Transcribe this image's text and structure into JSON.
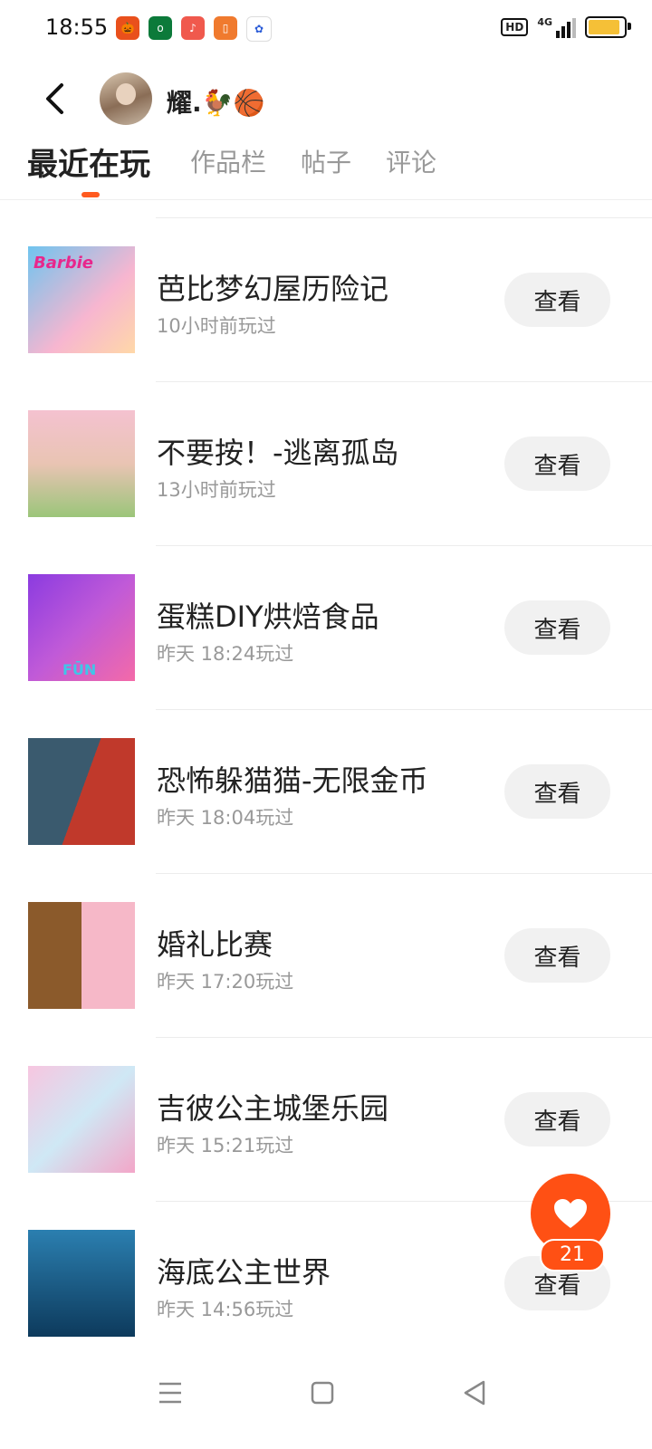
{
  "status_bar": {
    "time": "18:55",
    "network_badge": "HD",
    "network_type": "4G",
    "notification_icons": [
      "pumpkin-app-icon",
      "oppo-app-icon",
      "music-app-icon",
      "book-app-icon",
      "baidu-app-icon"
    ]
  },
  "header": {
    "username": "耀.🐓🏀",
    "back_icon": "chevron-left-icon"
  },
  "tabs": [
    {
      "label": "最近在玩",
      "active": true
    },
    {
      "label": "作品栏",
      "active": false
    },
    {
      "label": "帖子",
      "active": false
    },
    {
      "label": "评论",
      "active": false
    }
  ],
  "games": [
    {
      "name": "芭比梦幻屋历险记",
      "played": "10小时前玩过",
      "button": "查看",
      "thumb_text": "Barbie"
    },
    {
      "name": "不要按！-逃离孤岛",
      "played": "13小时前玩过",
      "button": "查看"
    },
    {
      "name": "蛋糕DIY烘焙食品",
      "played": "昨天 18:24玩过",
      "button": "查看",
      "thumb_text": "FŪN"
    },
    {
      "name": "恐怖躲猫猫-无限金币",
      "played": "昨天 18:04玩过",
      "button": "查看"
    },
    {
      "name": "婚礼比赛",
      "played": "昨天 17:20玩过",
      "button": "查看"
    },
    {
      "name": "吉彼公主城堡乐园",
      "played": "昨天 15:21玩过",
      "button": "查看"
    },
    {
      "name": "海底公主世界",
      "played": "昨天 14:56玩过",
      "button": "查看"
    }
  ],
  "like_fab": {
    "count": "21",
    "icon": "heart-icon"
  },
  "colors": {
    "accent": "#ff5014",
    "button_bg": "#f1f1f1",
    "muted_text": "#999999"
  }
}
